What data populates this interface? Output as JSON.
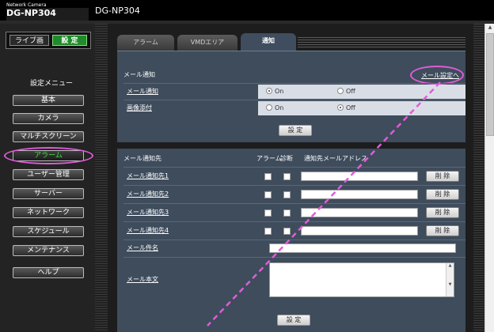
{
  "header": {
    "logo_sub": "Network Camera",
    "logo_main": "DG-NP304",
    "title": "DG-NP304"
  },
  "sidebar": {
    "mode_live": "ライブ画",
    "mode_setup": "設 定",
    "heading": "設定メニュー",
    "items": [
      {
        "label": "基本"
      },
      {
        "label": "カメラ"
      },
      {
        "label": "マルチスクリーン"
      },
      {
        "label": "アラーム",
        "active": true
      },
      {
        "label": "ユーザー管理"
      },
      {
        "label": "サーバー"
      },
      {
        "label": "ネットワーク"
      },
      {
        "label": "スケジュール"
      },
      {
        "label": "メンテナンス"
      },
      {
        "label": "ヘルプ"
      }
    ]
  },
  "tabs": [
    {
      "label": "アラーム"
    },
    {
      "label": "VMDエリア"
    },
    {
      "label": "通知",
      "active": true
    }
  ],
  "mail_notify_section": {
    "title": "メール通知",
    "settings_link": "メール設定へ",
    "rows": [
      {
        "label": "メール通知",
        "on": "On",
        "off": "Off",
        "selected": "On"
      },
      {
        "label": "画像添付",
        "on": "On",
        "off": "Off",
        "selected": "Off"
      }
    ],
    "setup_button": "設 定"
  },
  "recipients_section": {
    "title": "メール通知先",
    "col_alarm": "アラーム",
    "col_diag": "診断",
    "col_address": "通知先メールアドレス",
    "rows": [
      {
        "label": "メール通知先1",
        "delete": "削 除"
      },
      {
        "label": "メール通知先2",
        "delete": "削 除"
      },
      {
        "label": "メール通知先3",
        "delete": "削 除"
      },
      {
        "label": "メール通知先4",
        "delete": "削 除"
      }
    ],
    "subject_label": "メール件名",
    "body_label": "メール本文",
    "setup_button": "設 定"
  },
  "colors": {
    "accent_green": "#3fe63f",
    "highlight_pink": "#e05cd8",
    "panel_blue": "#3e4c5c"
  }
}
